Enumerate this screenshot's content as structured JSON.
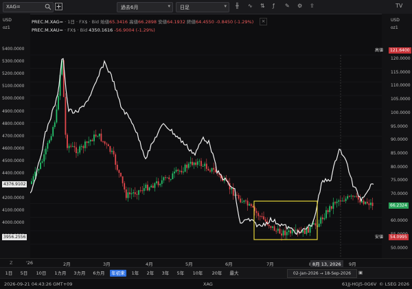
{
  "toolbar": {
    "search_value": "XAG=",
    "range_select": "過去6月",
    "interval_select": "日足",
    "tool_icons": [
      "candlestick-icon",
      "line-chart-icon",
      "compare-icon",
      "indicator-icon",
      "drawing-icon",
      "settings-icon",
      "share-icon"
    ]
  },
  "axes": {
    "left_currency": "USD",
    "left_unit": "oz1",
    "right_currency": "USD",
    "right_unit": "oz1",
    "left_ticks": [
      "5400.0000",
      "5300.0000",
      "5200.0000",
      "5100.0000",
      "5000.0000",
      "4900.0000",
      "4800.0000",
      "4700.0000",
      "4600.0000",
      "4500.0000",
      "4400.0000",
      "4300.0000",
      "4200.0000",
      "4100.0000",
      "4000.0000",
      "3900.0000"
    ],
    "right_ticks": [
      "120.0000",
      "115.0000",
      "110.0000",
      "105.0000",
      "100.0000",
      "95.0000",
      "90.0000",
      "85.0000",
      "80.0000",
      "75.0000",
      "70.0000",
      "65.0000",
      "60.0000",
      "55.0000",
      "50.0000"
    ],
    "left_price_tag": "4376.9102",
    "left_low_tag": "3956.2556",
    "right_high_label": "高値",
    "right_high_value": "121.6400",
    "right_low_label": "安値",
    "right_low_value": "54.0995",
    "right_last_value": "66.2324"
  },
  "legend": {
    "line1_symbol": "PREC.M.XAG=",
    "line1_meta": "· 1日 · FX$ · Bid",
    "line1_open_label": "始値",
    "line1_open": "65.3416",
    "line1_high_label": "高値",
    "line1_high": "66.2898",
    "line1_low_label": "安値",
    "line1_low": "64.1932",
    "line1_close_label": "終値",
    "line1_close": "64.4550",
    "line1_change": "-0.8450 (-1.29%)",
    "line2_symbol": "PREC.M.XAU=",
    "line2_meta": "· FX$ · Bid",
    "line2_value": "4350.1616",
    "line2_change": "-56.9004 (-1.29%)"
  },
  "xaxis": {
    "labels": [
      "'26",
      "2月",
      "3月",
      "4月",
      "5月",
      "6月",
      "7月",
      "8月",
      "9月"
    ],
    "crosshair_label": "8月 13, 2026"
  },
  "ranges": {
    "buttons": [
      "1日",
      "5日",
      "10日",
      "1カ月",
      "3カ月",
      "6カ月",
      "年初来",
      "1年",
      "2年",
      "3年",
      "5年",
      "10年",
      "20年",
      "最大"
    ],
    "selected_index": 6,
    "date_range": "02-Jan-2026 → 18-Sep-2026"
  },
  "status": {
    "timestamp": "2026-09-21 04:43:26 GMT+09",
    "ric": "XAG",
    "code": "61JJ-HGJ5-0G6V",
    "copyright": "© LSEG 2026"
  },
  "colors": {
    "up": "#26c26b",
    "down": "#e5484d",
    "line": "#f2f2f2",
    "highlight_box": "#e3d23a",
    "tag_green": "#2aa35a",
    "tag_red": "#c9353a"
  },
  "chart_data": {
    "type": "line",
    "x": [
      "Jan",
      "Feb",
      "Mar",
      "Apr",
      "May",
      "Jun",
      "Jul",
      "Aug",
      "Sep"
    ],
    "series": [
      {
        "name": "PREC.M.XAU=",
        "values": [
          4300,
          4950,
          5150,
          4600,
          4750,
          4350,
          4050,
          4100,
          4450,
          4350
        ]
      },
      {
        "name": "PREC.M.XAG=",
        "values": [
          70,
          118,
          90,
          78,
          80,
          68,
          56,
          58,
          68,
          64
        ]
      }
    ],
    "left_ylim": [
      3900,
      5400
    ],
    "right_ylim": [
      50,
      122
    ]
  }
}
